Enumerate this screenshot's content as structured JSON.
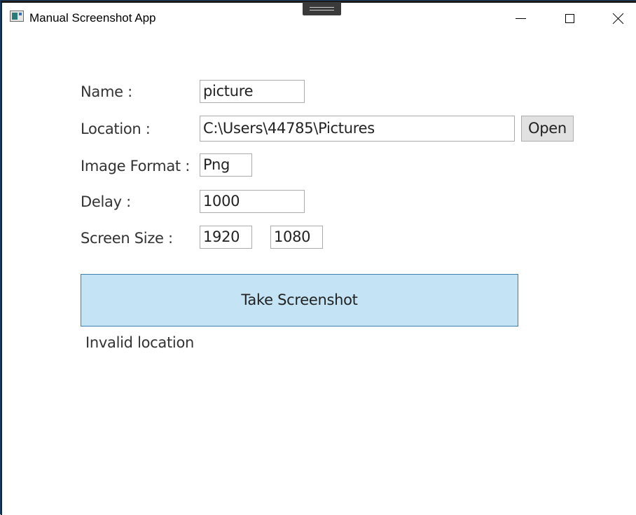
{
  "window": {
    "title": "Manual Screenshot App",
    "icon": "app-window-icon",
    "controls": {
      "minimize_icon": "minimize-icon",
      "maximize_icon": "maximize-icon",
      "close_icon": "close-icon"
    }
  },
  "form": {
    "name": {
      "label": "Name :",
      "value": "picture"
    },
    "location": {
      "label": "Location :",
      "value": "C:\\Users\\44785\\Pictures",
      "open_label": "Open"
    },
    "image_format": {
      "label": "Image Format :",
      "value": "Png"
    },
    "delay": {
      "label": "Delay :",
      "value": "1000"
    },
    "screen_size": {
      "label": "Screen Size :",
      "width": "1920",
      "height": "1080"
    }
  },
  "actions": {
    "take_screenshot_label": "Take Screenshot"
  },
  "status": {
    "message": "Invalid location"
  },
  "colors": {
    "primary_button_bg": "#c4e4f5",
    "primary_button_border": "#3c7fb1",
    "secondary_button_bg": "#e1e1e1",
    "field_border": "#ababab"
  }
}
